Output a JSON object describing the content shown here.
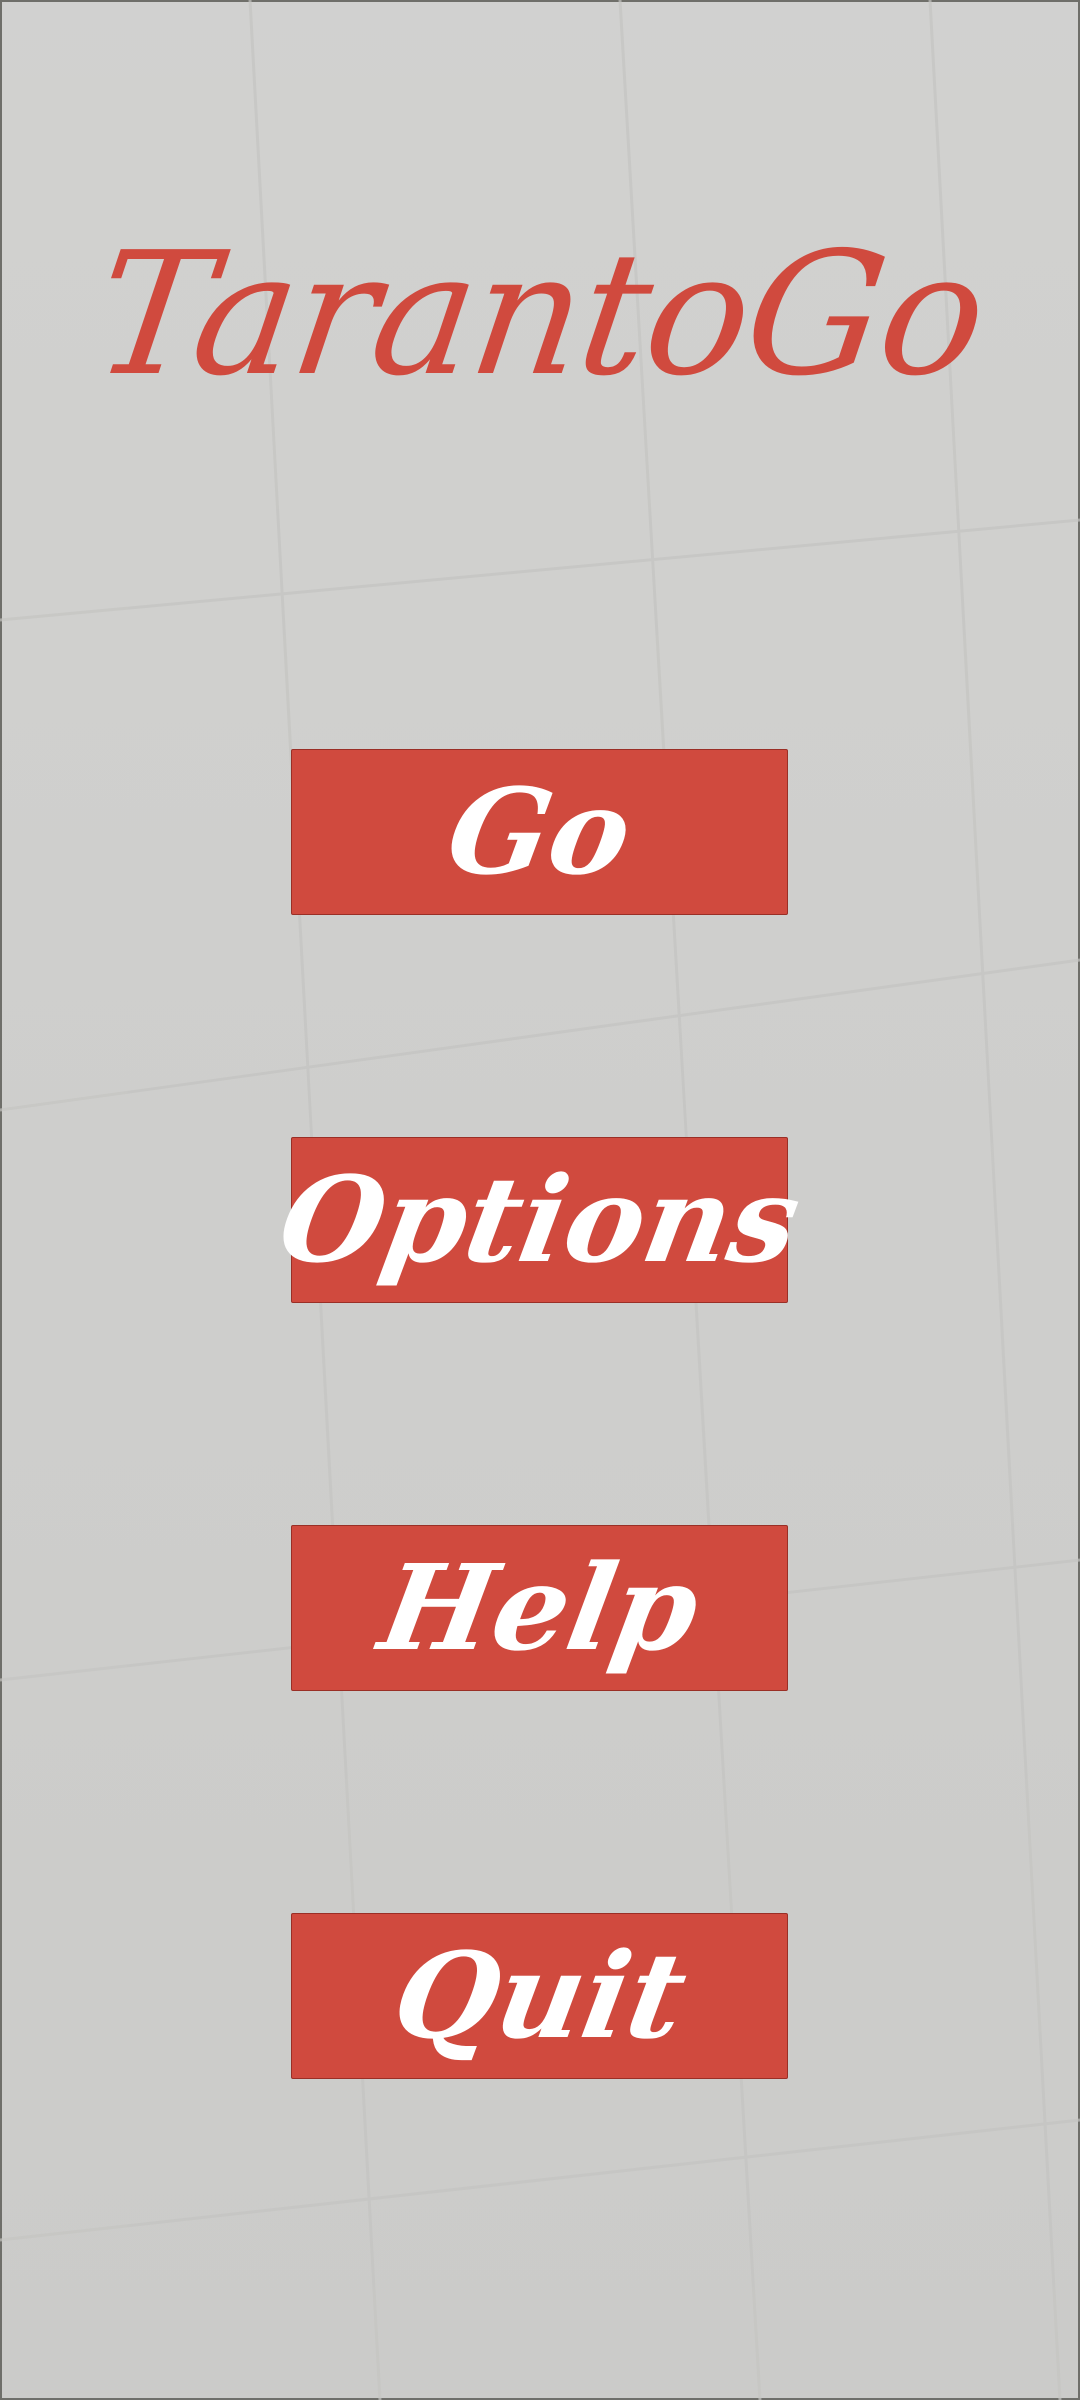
{
  "app": {
    "title": "TarantoGo"
  },
  "menu": {
    "go_label": "Go",
    "options_label": "Options",
    "help_label": "Help",
    "quit_label": "Quit"
  },
  "colors": {
    "accent": "#d04a3e",
    "background": "#cfcfcd",
    "button_text": "#ffffff"
  }
}
